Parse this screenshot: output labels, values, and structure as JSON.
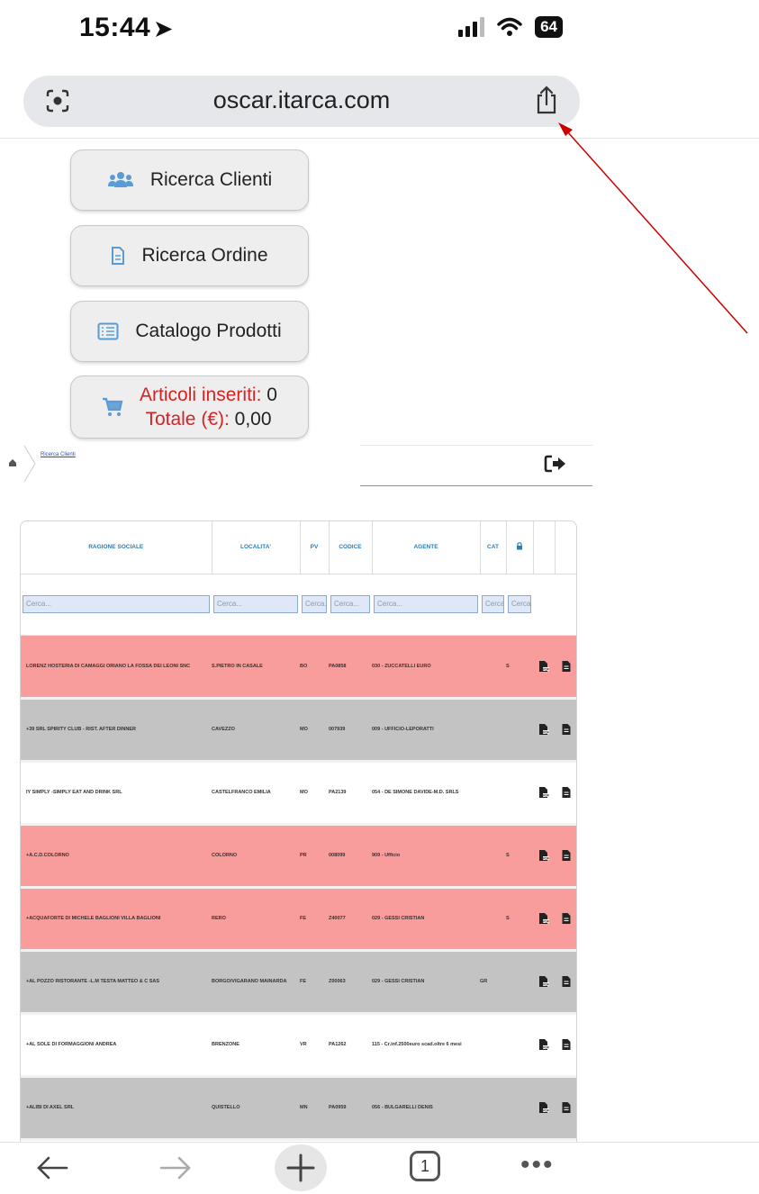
{
  "status_bar": {
    "time": "15:44",
    "battery": "64"
  },
  "browser": {
    "url": "oscar.itarca.com"
  },
  "menu": {
    "search_clients": "Ricerca Clienti",
    "search_order": "Ricerca Ordine",
    "product_catalog": "Catalogo Prodotti",
    "cart": {
      "items_label": "Articoli inseriti:",
      "items_value": "0",
      "total_label": "Totale (€):",
      "total_value": "0,00"
    }
  },
  "breadcrumb": {
    "current": "Ricerca Clienti"
  },
  "table": {
    "headers": {
      "ragione_sociale": "RAGIONE SOCIALE",
      "localita": "LOCALITA'",
      "pv": "PV",
      "codice": "CODICE",
      "agente": "AGENTE",
      "cat": "CAT"
    },
    "filter_placeholder": "Cerca...",
    "rows": [
      {
        "ragione": "LORENZ HOSTERIA DI CAMAGGI ORIANO LA FOSSA DEI LEONI SNC",
        "localita": "S.PIETRO IN CASALE",
        "pv": "BO",
        "codice": "PA0858",
        "agente": "030 - ZUCCATELLI EURO",
        "cat": "",
        "flag": "S"
      },
      {
        "ragione": "+39 SRL          SPIRITY CLUB - RIST. AFTER DINNER",
        "localita": "CAVEZZO",
        "pv": "MO",
        "codice": "007939",
        "agente": "009 - UFFICIO-LEPORATTI",
        "cat": "",
        "flag": ""
      },
      {
        "ragione": "IY SIMPLY -SIMPLY EAT AND DRINK SRL",
        "localita": "CASTELFRANCO EMILIA",
        "pv": "MO",
        "codice": "PA2139",
        "agente": "054 - DE SIMONE DAVIDE-M.D. SRLS",
        "cat": "",
        "flag": ""
      },
      {
        "ragione": "+A.C.D.COLORNO",
        "localita": "COLORNO",
        "pv": "PR",
        "codice": "008099",
        "agente": "909 - Ufficio",
        "cat": "",
        "flag": "S"
      },
      {
        "ragione": "+ACQUAFORTE DI MICHELE BAGLIONI  VILLA BAGLIONI",
        "localita": "RERO",
        "pv": "FE",
        "codice": "Z40077",
        "agente": "029 - GESSI CRISTIAN",
        "cat": "",
        "flag": "S"
      },
      {
        "ragione": "+AL POZZO RISTORANTE -L.M TESTA  MATTEO & C SAS",
        "localita": "BORGO/VIGARANO MAINARDA",
        "pv": "FE",
        "codice": "Z00063",
        "agente": "029 - GESSI CRISTIAN",
        "cat": "GR",
        "flag": ""
      },
      {
        "ragione": "+AL SOLE DI FORMAGGIONI ANDREA",
        "localita": "BRENZONE",
        "pv": "VR",
        "codice": "PA1262",
        "agente": "115 - Cr.inf.2500euro scad.oltre 6 mesi",
        "cat": "",
        "flag": ""
      },
      {
        "ragione": "+ALIBI DI AXEL SRL",
        "localita": "QUISTELLO",
        "pv": "MN",
        "codice": "PA0959",
        "agente": "056 - BULGARELLI DENIS",
        "cat": "",
        "flag": ""
      }
    ]
  },
  "bottom_nav": {
    "tab_count": "1",
    "more": "•••"
  },
  "colors": {
    "row_red": "#f99c9c",
    "row_grey": "#c3c3c3",
    "header_blue": "#2a7db8",
    "cart_red": "#d62222",
    "annotation": "#cc0000"
  },
  "icons": [
    "location-arrow-icon",
    "signal-icon",
    "wifi-icon",
    "lens-icon",
    "share-icon",
    "users-icon",
    "document-icon",
    "list-icon",
    "cart-icon",
    "home-icon",
    "logout-icon",
    "lock-icon",
    "pdf-icon",
    "file-icon",
    "back-arrow-icon",
    "forward-arrow-icon",
    "plus-icon"
  ]
}
